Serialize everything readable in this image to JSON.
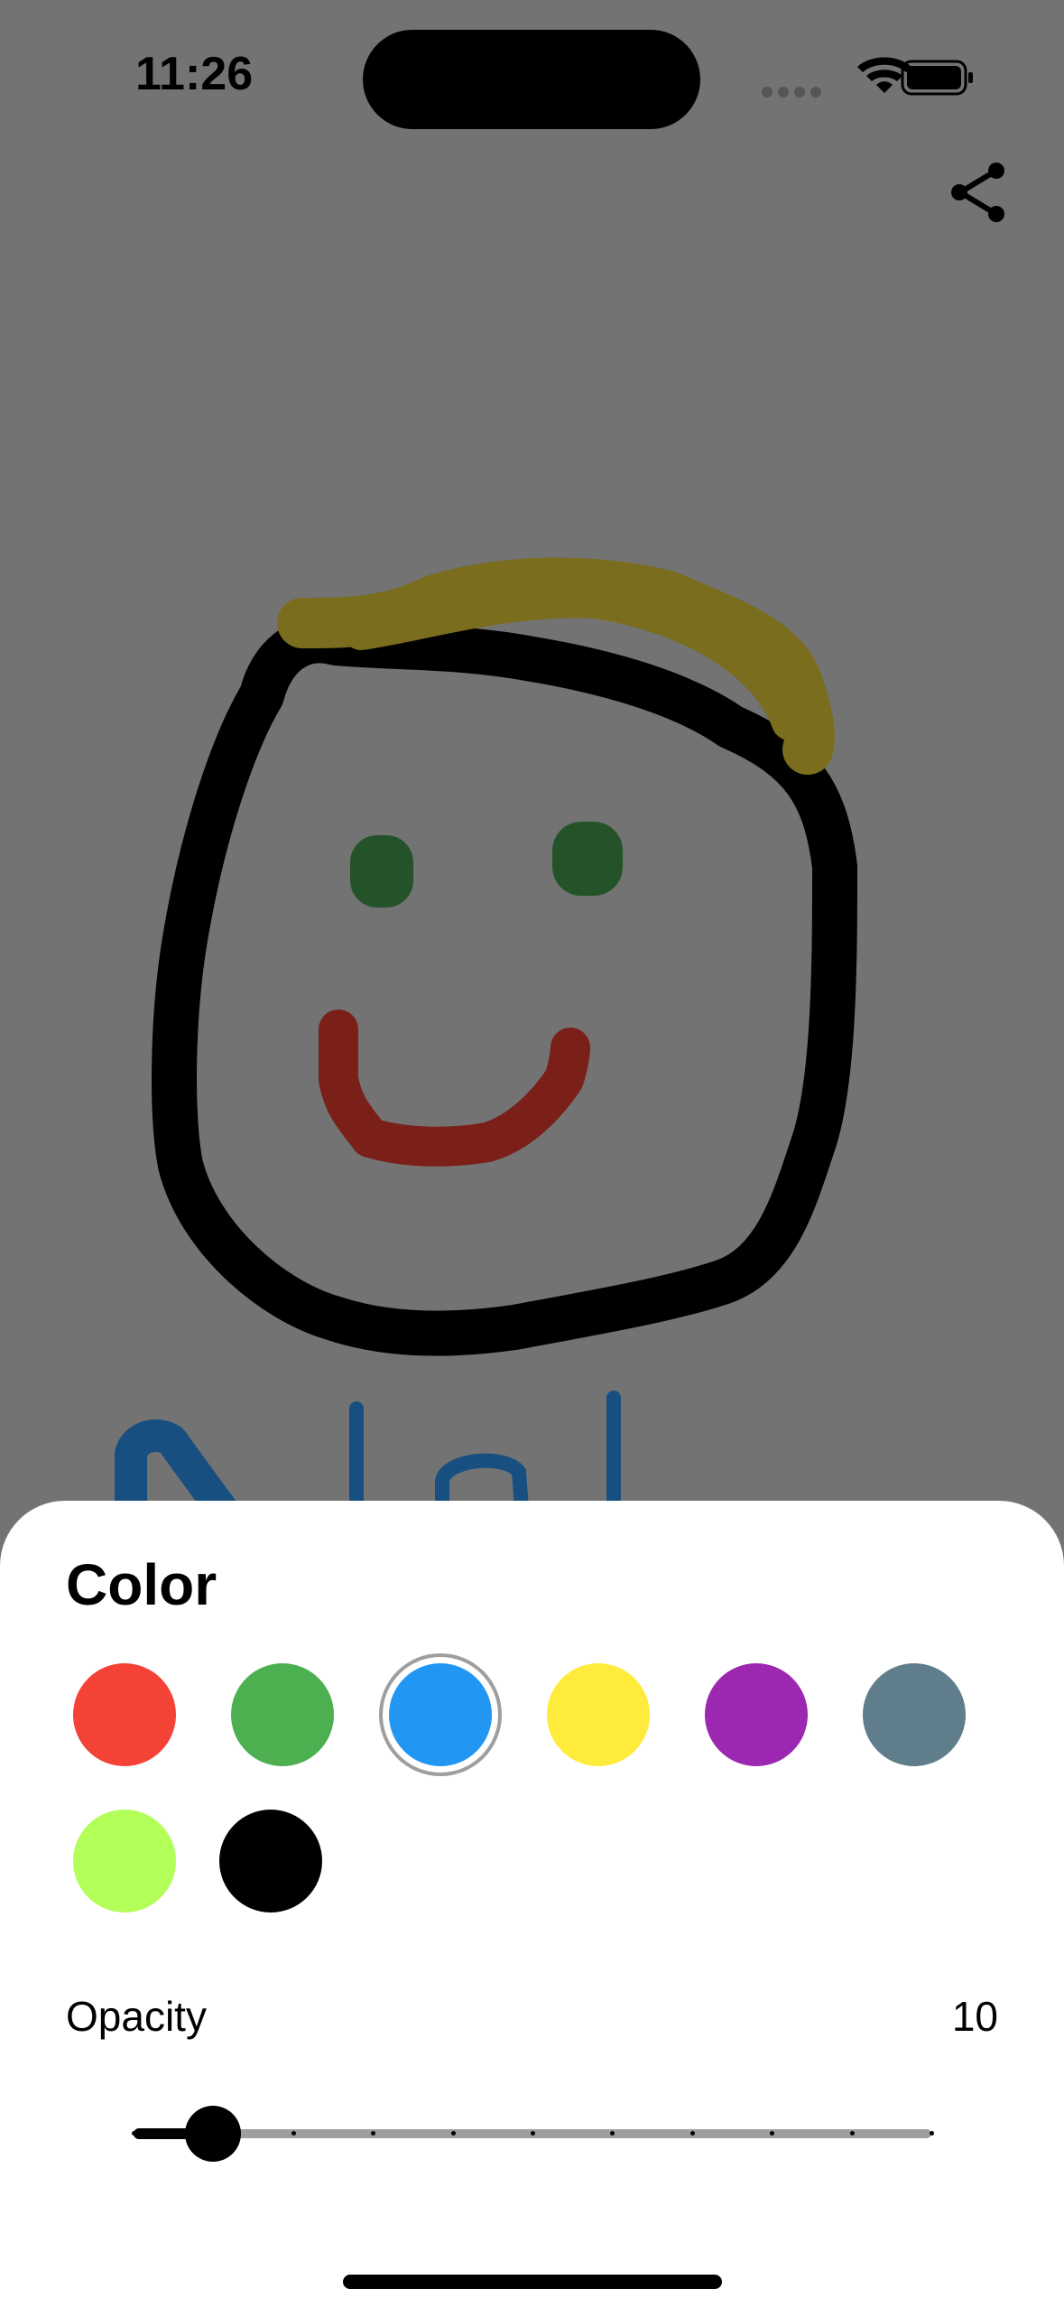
{
  "status_bar": {
    "time": "11:26",
    "signal_icon": "cellular-signal-icon",
    "wifi_icon": "wifi-icon",
    "battery_icon": "battery-icon"
  },
  "toolbar": {
    "share_icon": "share-icon"
  },
  "canvas": {
    "background": "#737373",
    "strokes": [
      {
        "name": "face-outline",
        "color": "#000000"
      },
      {
        "name": "hair",
        "color": "#7a6d1e"
      },
      {
        "name": "left-eye",
        "color": "#24532a"
      },
      {
        "name": "right-eye",
        "color": "#24532a"
      },
      {
        "name": "mouth",
        "color": "#7a2019"
      },
      {
        "name": "blue-scribble",
        "color": "#174f80"
      }
    ]
  },
  "sheet": {
    "title": "Color",
    "colors": [
      {
        "name": "red",
        "hex": "#F44336"
      },
      {
        "name": "green",
        "hex": "#4CAF50"
      },
      {
        "name": "blue",
        "hex": "#2196F3",
        "selected": true
      },
      {
        "name": "yellow",
        "hex": "#FFEB3B"
      },
      {
        "name": "purple",
        "hex": "#9C27B0"
      },
      {
        "name": "blue-grey",
        "hex": "#607D8B"
      },
      {
        "name": "lime",
        "hex": "#B2FF59"
      },
      {
        "name": "black",
        "hex": "#000000"
      }
    ],
    "opacity": {
      "label": "Opacity",
      "value": "10",
      "level": 0.1,
      "divisions": 10
    }
  }
}
